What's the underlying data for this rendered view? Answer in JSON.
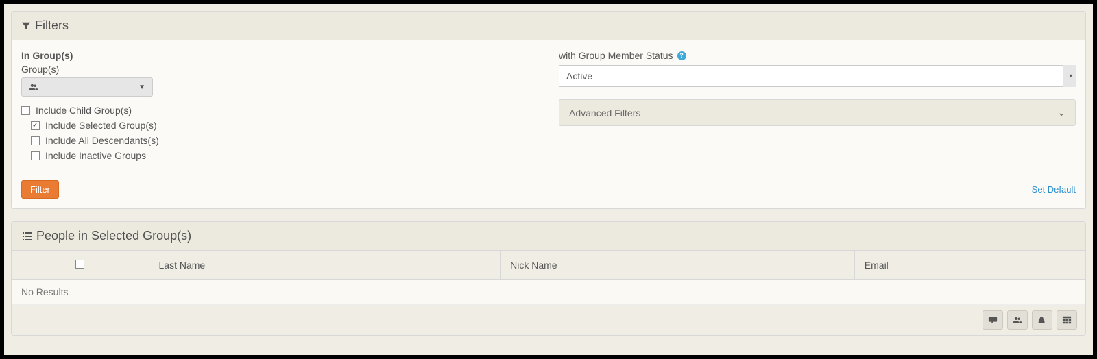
{
  "filters": {
    "title": "Filters",
    "in_groups_label": "In Group(s)",
    "groups_label": "Group(s)",
    "include_child_label": "Include Child Group(s)",
    "include_child_checked": false,
    "children": [
      {
        "label": "Include Selected Group(s)",
        "checked": true
      },
      {
        "label": "Include All Descendants(s)",
        "checked": false
      },
      {
        "label": "Include Inactive Groups",
        "checked": false
      }
    ],
    "status_label": "with Group Member Status",
    "status_value": "Active",
    "advanced_label": "Advanced Filters",
    "filter_button": "Filter",
    "set_default": "Set Default"
  },
  "people": {
    "title": "People in Selected Group(s)",
    "columns": {
      "last_name": "Last Name",
      "nick_name": "Nick Name",
      "email": "Email"
    },
    "no_results": "No Results"
  }
}
